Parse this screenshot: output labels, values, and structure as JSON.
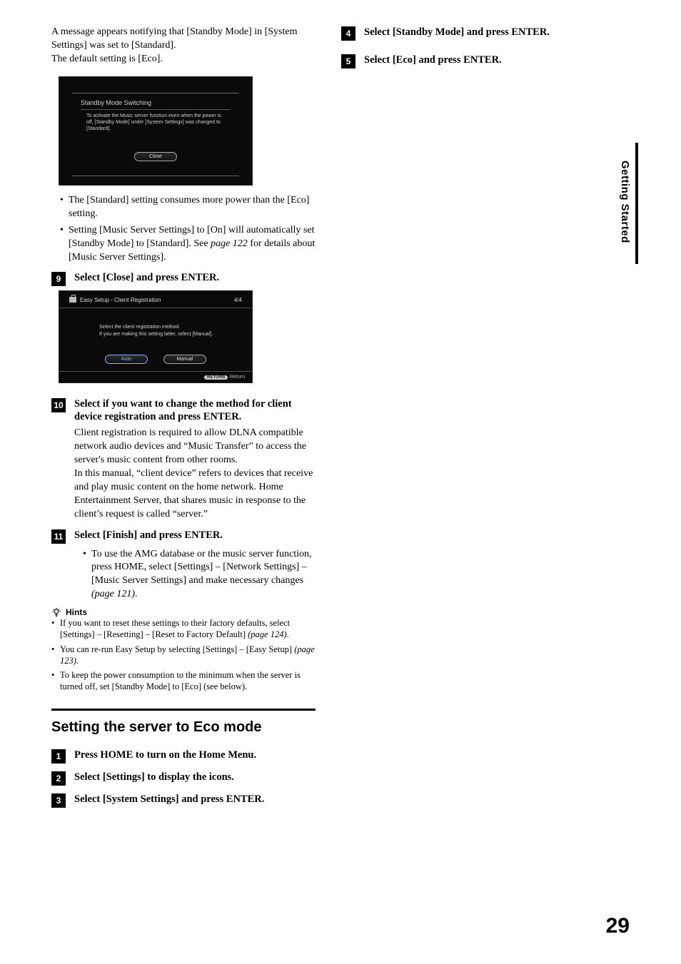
{
  "side_tab": "Getting Started",
  "page_number": "29",
  "left": {
    "intro_l1": "A message appears notifying that [Standby Mode] in [System Settings] was set to [Standard].",
    "intro_l3": "The default setting is [Eco].",
    "shot1": {
      "title": "Standby Mode Switching",
      "body": "To activate the Music server function even when the power is off, [Standby Mode] under [System Settings] was changed to [Standard].",
      "close": "Close"
    },
    "bullets_a": {
      "b1": "The [Standard] setting consumes more power than the [Eco] setting.",
      "b2_a": "Setting [Music Server Settings] to [On] will automatically set [Standby Mode] to [Standard]. See ",
      "b2_ref": "page 122",
      "b2_b": " for details about [Music Server Settings]."
    },
    "step9": {
      "num": "9",
      "text": "Select [Close] and press ENTER."
    },
    "shot2": {
      "header": "Easy Setup - Client Registration",
      "counter": "4/4",
      "body": "Select the client registration method.\nIf you are making this setting latter, select [Manual].",
      "auto": "Auto",
      "manual": "Manual",
      "return_badge": "RETURN",
      "return": "Return"
    },
    "step10": {
      "num": "10",
      "text": "Select if you want to change the method for client device registration and press ENTER.",
      "body": "Client registration is required to allow DLNA compatible network audio devices and “Music Transfer” to access the server's music content from other rooms.\nIn this manual, “client device” refers  to devices that receive and play music content on the home network. Home Entertainment Server, that shares music in response to the client’s request is called “server.”"
    },
    "step11": {
      "num": "11",
      "text": "Select [Finish] and press ENTER.",
      "bul_a": "To use the AMG database or the music server function, press HOME, select [Settings] – [Network Settings] – [Music Server Settings] and make necessary changes ",
      "bul_ref": "(page 121)",
      "bul_b": "."
    },
    "hints": {
      "label": "Hints",
      "h1_a": "If you want to reset these settings to their factory defaults, select [Settings] – [Resetting] – [Reset to Factory Default] ",
      "h1_ref": "(page 124)",
      "h1_b": ".",
      "h2_a": "You can re-run Easy Setup by selecting [Settings] – [Easy Setup] ",
      "h2_ref": "(page 123)",
      "h2_b": ".",
      "h3": "To keep the power consumption to the minimum when the server is turned off, set [Standby Mode] to [Eco] (see below)."
    },
    "section_title": "Setting the server to Eco mode",
    "eco_steps": {
      "s1_num": "1",
      "s1": "Press HOME to turn on the Home Menu.",
      "s2_num": "2",
      "s2": "Select [Settings] to display the icons.",
      "s3_num": "3",
      "s3": "Select [System Settings] and press ENTER."
    }
  },
  "right": {
    "s4_num": "4",
    "s4": "Select [Standby Mode] and press ENTER.",
    "s5_num": "5",
    "s5": "Select [Eco] and press ENTER."
  }
}
